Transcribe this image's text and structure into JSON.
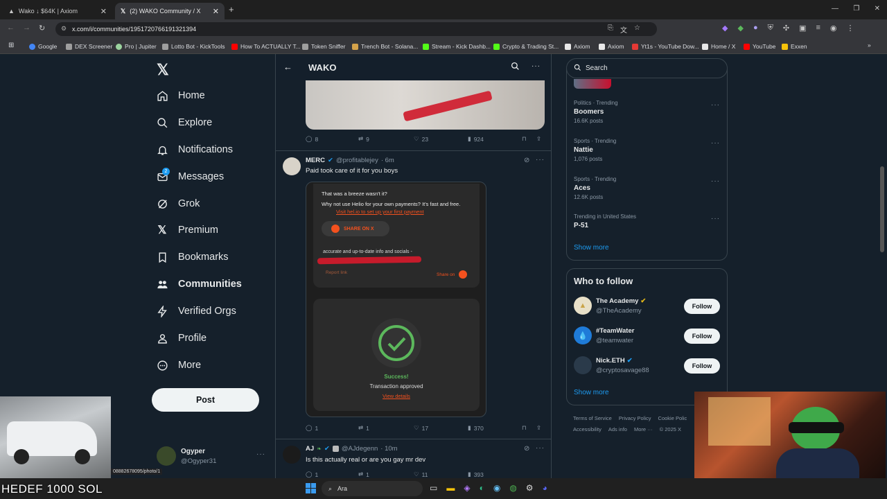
{
  "browser": {
    "tabs": [
      {
        "label": "Wako ↓ $64K | Axiom",
        "close": "✕"
      },
      {
        "label": "(2) WAKO Community / X",
        "close": "✕"
      }
    ],
    "new_tab": "+",
    "url": "x.com/i/communities/1951720766191321394",
    "bookmarks": [
      {
        "label": "Google",
        "color": "#4285f4"
      },
      {
        "label": "DEX Screener",
        "color": "#9e9e9e"
      },
      {
        "label": "Pro | Jupiter",
        "color": "#9bd39e"
      },
      {
        "label": "Lotto Bot - KickTools",
        "color": "#9e9e9e"
      },
      {
        "label": "How To ACTUALLY T...",
        "color": "#ff0000"
      },
      {
        "label": "Token Sniffer",
        "color": "#9e9e9e"
      },
      {
        "label": "Trench Bot - Solana...",
        "color": "#d4a24a"
      },
      {
        "label": "Stream - Kick Dashb...",
        "color": "#53fc18"
      },
      {
        "label": "Crypto & Trading St...",
        "color": "#53fc18"
      },
      {
        "label": "Axiom",
        "color": "#e8e8e8"
      },
      {
        "label": "Axiom",
        "color": "#e8e8e8"
      },
      {
        "label": "Yt1s - YouTube Dow...",
        "color": "#e53935"
      },
      {
        "label": "Home / X",
        "color": "#e8e8e8"
      },
      {
        "label": "YouTube",
        "color": "#ff0000"
      },
      {
        "label": "Exxen",
        "color": "#f6c20a"
      }
    ]
  },
  "sidebar": {
    "items": [
      {
        "label": "Home",
        "icon": "home-icon"
      },
      {
        "label": "Explore",
        "icon": "search-icon"
      },
      {
        "label": "Notifications",
        "icon": "bell-icon"
      },
      {
        "label": "Messages",
        "icon": "mail-icon",
        "badge": "2"
      },
      {
        "label": "Grok",
        "icon": "grok-icon"
      },
      {
        "label": "Premium",
        "icon": "x-logo-icon"
      },
      {
        "label": "Bookmarks",
        "icon": "bookmark-icon"
      },
      {
        "label": "Communities",
        "icon": "people-icon"
      },
      {
        "label": "Verified Orgs",
        "icon": "bolt-icon"
      },
      {
        "label": "Profile",
        "icon": "person-icon"
      },
      {
        "label": "More",
        "icon": "more-circle-icon"
      }
    ],
    "post_label": "Post",
    "account": {
      "name": "Ogyper",
      "handle": "@Ogyper31"
    }
  },
  "header": {
    "title": "WAKO",
    "back": "←"
  },
  "posts": [
    {
      "replies": "8",
      "reposts": "9",
      "likes": "23",
      "views": "924"
    },
    {
      "name": "MERC",
      "handle": "@profitablejey",
      "time": "· 6m",
      "text": "Paid took care of it for you boys",
      "card": {
        "line1": "That was a breeze wasn't it?",
        "line2": "Why not use Helio for your own payments? It's fast and free.",
        "link": "Visit hel.io to set up your first payment",
        "share_btn": "SHARE ON X",
        "info": "accurate and up-to-date info and socials -",
        "report": "Report link",
        "share_on": "Share on",
        "success": "Success!",
        "approved": "Transaction approved",
        "details": "View details"
      },
      "replies": "1",
      "reposts": "1",
      "likes": "17",
      "views": "370"
    },
    {
      "name": "AJ",
      "handle": "@AJdegenn",
      "time": "· 10m",
      "text": "Is this actually real or are you gay mr dev",
      "replies": "1",
      "reposts": "1",
      "likes": "11",
      "views": "393"
    }
  ],
  "search": {
    "placeholder": "Search"
  },
  "trends": [
    {
      "meta": "Politics · Trending",
      "name": "Boomers",
      "count": "16.6K posts"
    },
    {
      "meta": "Sports · Trending",
      "name": "Nattie",
      "count": "1,076 posts"
    },
    {
      "meta": "Sports · Trending",
      "name": "Aces",
      "count": "12.6K posts"
    },
    {
      "meta": "Trending in United States",
      "name": "P-51",
      "count": ""
    }
  ],
  "show_more": "Show more",
  "who_to_follow": {
    "title": "Who to follow",
    "accounts": [
      {
        "name": "The Academy",
        "handle": "@TheAcademy",
        "button": "Follow"
      },
      {
        "name": "#TeamWater",
        "handle": "@teamwater",
        "button": "Follow"
      },
      {
        "name": "Nick.ETH",
        "handle": "@cryptosavage88",
        "button": "Follow"
      }
    ],
    "show_more": "Show more"
  },
  "footer": {
    "links": [
      "Terms of Service",
      "Privacy Policy",
      "Cookie Polic",
      "Accessibility",
      "Ads info",
      "More ···",
      "© 2025 X"
    ]
  },
  "overlay": {
    "caption": "HEDEF 1000 SOL",
    "status_url": "08882678095/photo/1"
  },
  "taskbar": {
    "search_label": "Ara"
  },
  "colors": {
    "background": "#15202b",
    "accent": "#1d9bf0",
    "orange": "#f4511e",
    "success": "#5cb85c"
  }
}
